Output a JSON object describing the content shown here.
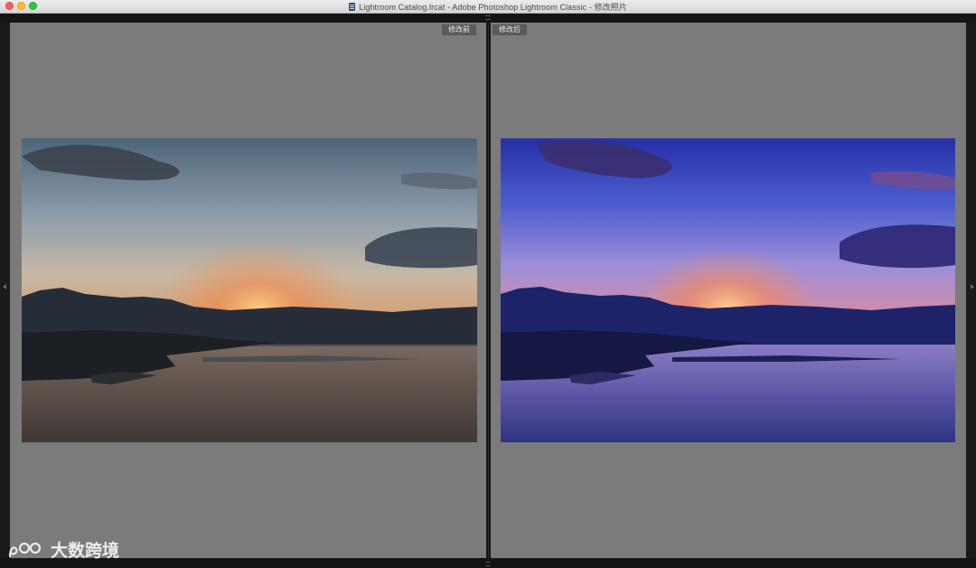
{
  "window": {
    "title": "Lightroom Catalog.lrcat - Adobe Photoshop Lightroom Classic - 修改照片"
  },
  "compare": {
    "before_label": "修改前",
    "after_label": "修改后"
  },
  "watermark": {
    "text": "大数跨境"
  },
  "colors": {
    "pane_background": "#7b7b7b",
    "window_background": "#1a1a1a"
  },
  "icons": {
    "document": "document-icon",
    "watermark_logo": "watermark-logo-icon"
  }
}
